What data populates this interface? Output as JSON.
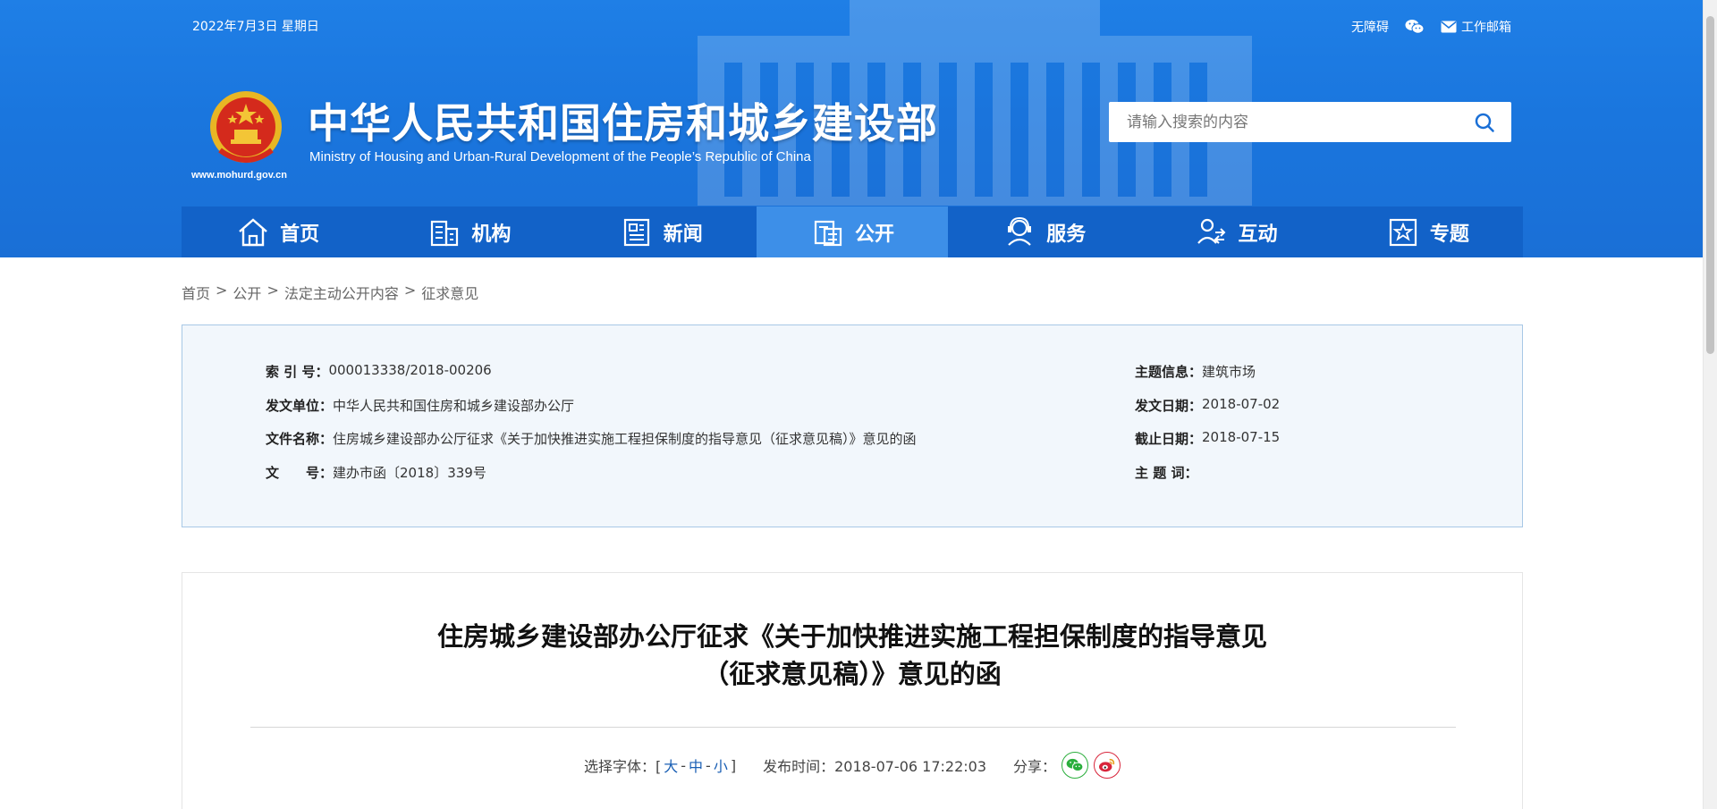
{
  "header": {
    "date": "2022年7月3日 星期日",
    "accessibility": "无障碍",
    "mail": "工作邮箱",
    "site_title": "中华人民共和国住房和城乡建设部",
    "site_subtitle": "Ministry of Housing and Urban-Rural Development of the People’s Republic of China",
    "site_url": "www.mohurd.gov.cn",
    "search_placeholder": "请输入搜索的内容"
  },
  "nav": [
    {
      "label": "首页",
      "icon": "home-icon"
    },
    {
      "label": "机构",
      "icon": "building-icon"
    },
    {
      "label": "新闻",
      "icon": "news-icon"
    },
    {
      "label": "公开",
      "icon": "open-icon",
      "active": true
    },
    {
      "label": "服务",
      "icon": "service-icon"
    },
    {
      "label": "互动",
      "icon": "interact-icon"
    },
    {
      "label": "专题",
      "icon": "topic-icon"
    }
  ],
  "breadcrumb": [
    "首页",
    "公开",
    "法定主动公开内容",
    "征求意见"
  ],
  "info": {
    "index_label": "索 引 号：",
    "index_value": "000013338/2018-00206",
    "unit_label": "发文单位：",
    "unit_value": "中华人民共和国住房和城乡建设部办公厅",
    "name_label": "文件名称：",
    "name_value": "住房城乡建设部办公厅征求《关于加快推进实施工程担保制度的指导意见（征求意见稿）》意见的函",
    "doc_label": "文　　号：",
    "doc_value": "建办市函〔2018〕339号",
    "topic_label": "主题信息：",
    "topic_value": "建筑市场",
    "date_label": "发文日期：",
    "date_value": "2018-07-02",
    "deadline_label": "截止日期：",
    "deadline_value": "2018-07-15",
    "keyword_label": "主 题 词：",
    "keyword_value": ""
  },
  "article": {
    "title_line1": "住房城乡建设部办公厅征求《关于加快推进实施工程担保制度的指导意见",
    "title_line2": "（征求意见稿）》意见的函",
    "font_select_label": "选择字体：[",
    "font_large": "大",
    "font_medium": "中",
    "font_small": "小",
    "font_close": "]",
    "dash": "-",
    "publish_time": "发布时间：2018-07-06 17:22:03",
    "share_label": "分享："
  },
  "colors": {
    "header_blue": "#1a76de",
    "nav_blue": "#1262c8",
    "nav_active": "#3d8fe8",
    "wechat_green": "#2aae3c",
    "weibo_red": "#d8243a"
  }
}
